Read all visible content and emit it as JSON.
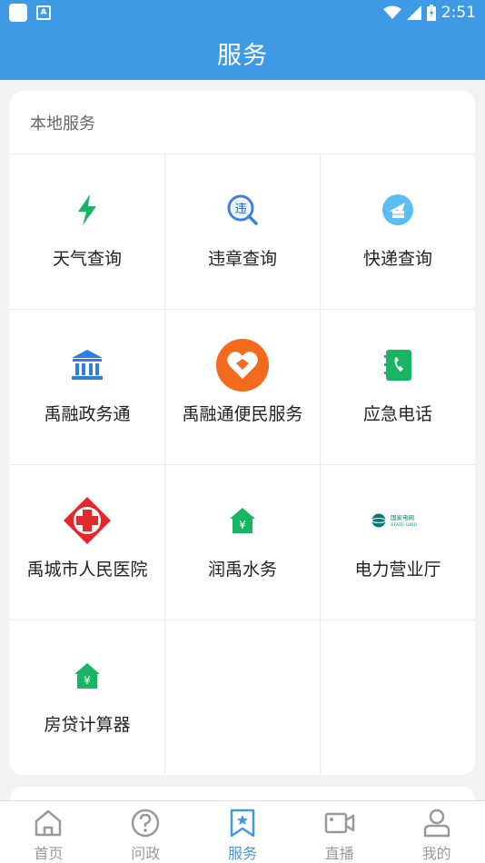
{
  "status_bar": {
    "time": "2:51"
  },
  "app_bar": {
    "title": "服务"
  },
  "local_services": {
    "header": "本地服务",
    "items": [
      {
        "label": "天气查询",
        "icon": "lightning-icon"
      },
      {
        "label": "违章查询",
        "icon": "violation-search-icon"
      },
      {
        "label": "快递查询",
        "icon": "express-globe-icon"
      },
      {
        "label": "禹融政务通",
        "icon": "government-building-icon"
      },
      {
        "label": "禹融通便民服务",
        "icon": "heart-service-icon"
      },
      {
        "label": "应急电话",
        "icon": "phone-book-icon"
      },
      {
        "label": "禹城市人民医院",
        "icon": "hospital-cross-icon"
      },
      {
        "label": "润禹水务",
        "icon": "house-yen-icon"
      },
      {
        "label": "电力营业厅",
        "icon": "state-grid-logo"
      },
      {
        "label": "房贷计算器",
        "icon": "house-yen-icon"
      }
    ],
    "state_grid_logo_text": [
      "国家电网",
      "STATE GRID"
    ]
  },
  "tab_bar": {
    "tabs": [
      {
        "label": "首页",
        "icon": "home-icon"
      },
      {
        "label": "问政",
        "icon": "question-icon"
      },
      {
        "label": "服务",
        "icon": "bookmark-star-icon",
        "active": true
      },
      {
        "label": "直播",
        "icon": "video-camera-icon"
      },
      {
        "label": "我的",
        "icon": "user-icon"
      }
    ]
  },
  "colors": {
    "primary": "#3f9ae6",
    "green": "#19b565",
    "orange": "#f26b1d",
    "red": "#e3282c",
    "tab_inactive": "#999999"
  }
}
